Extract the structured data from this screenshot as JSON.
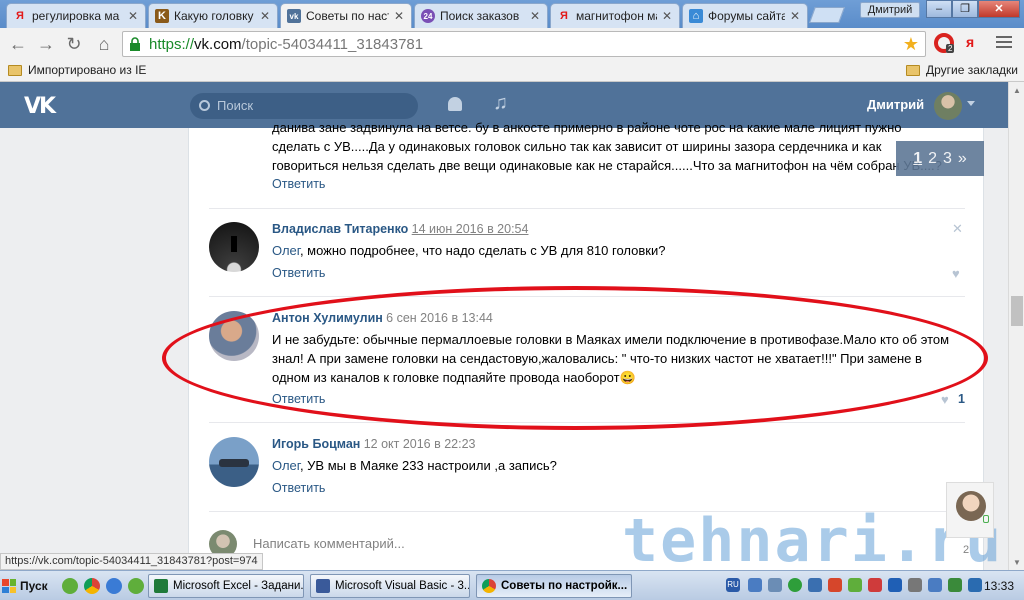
{
  "browser": {
    "tabs": [
      {
        "label": "регулировка ма",
        "icon": "yandex-icon",
        "color": "#e21a1a"
      },
      {
        "label": "Какую головку",
        "icon": "forum-icon",
        "color": "#8a5a1a"
      },
      {
        "label": "Советы по наст",
        "icon": "vk-icon",
        "color": "#507299",
        "active": true
      },
      {
        "label": "Поиск заказов",
        "icon": "globe-icon",
        "color": "#7a4fb5"
      },
      {
        "label": "магнитофон ма",
        "icon": "yandex-icon",
        "color": "#e21a1a"
      },
      {
        "label": "Форумы сайта",
        "icon": "house-icon",
        "color": "#3a8ad6"
      }
    ],
    "profile": "Дмитрий",
    "url": {
      "scheme": "https://",
      "host": "vk.com",
      "path": "/topic-54034411_31843781"
    },
    "bookmarks": {
      "left": "Импортировано из IE",
      "right": "Другие закладки"
    },
    "ext_badge": "2",
    "ext_ya": "я",
    "status_url": "https://vk.com/topic-54034411_31843781?post=974"
  },
  "vk": {
    "logo": "VK",
    "search_placeholder": "Поиск",
    "user_name": "Дмитрий",
    "pager": {
      "pages": [
        "1",
        "2",
        "3"
      ],
      "next": "»"
    },
    "partial_post": {
      "line1": "данива зане задвинула на ветсе. бу в анкосте примерно в районе чоте рос на какие мале лицият пужно",
      "line2": "сделать с УВ.....Да у одинаковых головок сильно так как зависит от ширины зазора сердечника и как",
      "line3": "говориться нельзя сделать две вещи одинаковые как не старайся......Что за магнитофон на чём собран УВ....?",
      "reply": "Ответить"
    },
    "comments": [
      {
        "author": "Владислав Титаренко",
        "date": "14 июн 2016 в 20:54",
        "mention": "Олег",
        "lines": [
          ", можно подробнее, что надо сделать с УВ для 810 головки?"
        ],
        "reply": "Ответить",
        "likes": ""
      },
      {
        "author": "Антон Хулимулин",
        "date": "6 сен 2016 в 13:44",
        "mention": "",
        "lines": [
          "И не забудьте: обычные пермаллоевые головки в Маяках имели подключение в противофазе.Мало кто об этом",
          "знал! А при замене головки на сендастовую,жаловались: \" что-то низких частот не хватает!!!\" При замене в",
          "одном из каналов к головке подпаяйте провода наоборот"
        ],
        "emoji": "😀",
        "reply": "Ответить",
        "likes": "1"
      },
      {
        "author": "Игорь Боцман",
        "date": "12 окт 2016 в 22:23",
        "mention": "Олег",
        "lines": [
          ", УВ мы в Маяке 233 настроили ,а запись?"
        ],
        "reply": "Ответить",
        "likes": ""
      }
    ],
    "comment_placeholder": "Написать комментарий...",
    "comment_counter": "2"
  },
  "watermark": "tehnari.ru",
  "taskbar": {
    "start": "Пуск",
    "tasks": [
      {
        "label": "Microsoft Excel - Задани...",
        "color": "#1f7a3a"
      },
      {
        "label": "Microsoft Visual Basic - 3...",
        "color": "#3a5a9a"
      },
      {
        "label": "Советы по настройк...",
        "color": "#507299",
        "active": true
      }
    ],
    "lang": "RU",
    "clock": "13:33"
  },
  "colors": {
    "vk_blue": "#507299",
    "link": "#2a5885",
    "highlight_ellipse": "#e1101a"
  }
}
